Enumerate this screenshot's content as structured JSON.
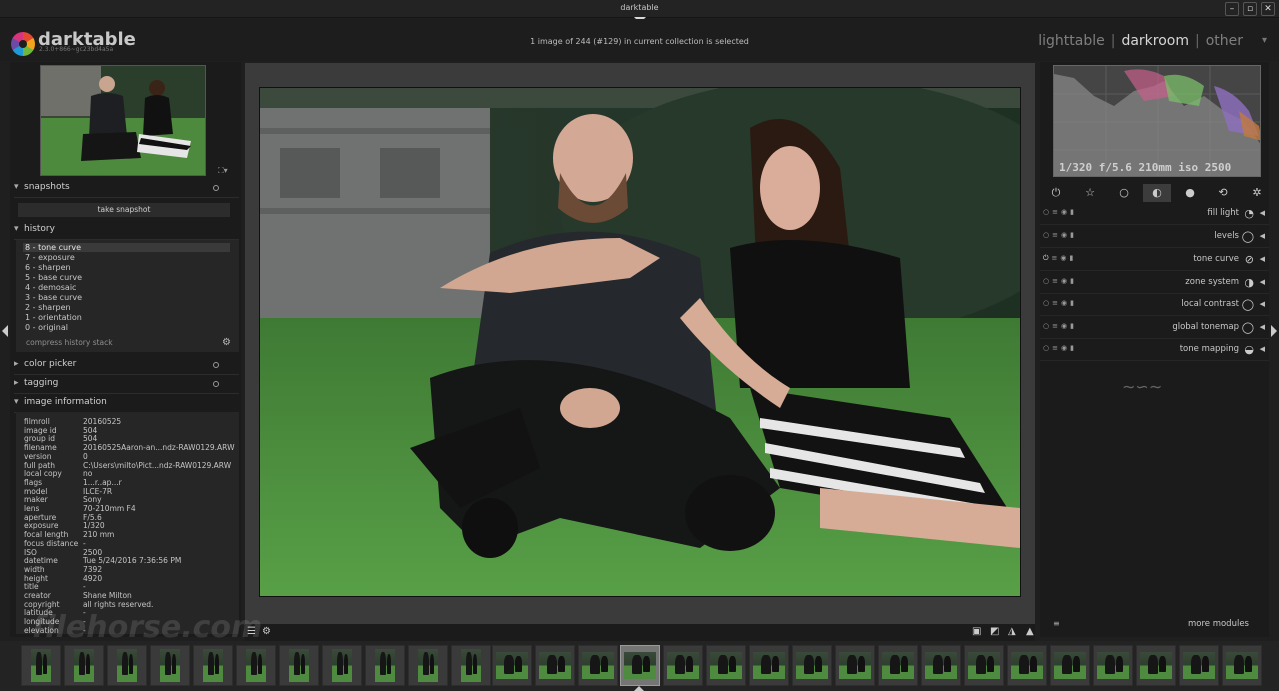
{
  "window": {
    "title": "darktable",
    "buttons": [
      "–",
      "▫",
      "✕"
    ]
  },
  "header": {
    "app_name": "darktable",
    "version": "2.3.0+866~gc23bd4a5a",
    "collection_status": "1 image of 244 (#129) in current collection is selected",
    "views": [
      {
        "label": "lighttable",
        "active": false
      },
      {
        "label": "darkroom",
        "active": true
      },
      {
        "label": "other",
        "active": false
      }
    ],
    "separator": "|"
  },
  "left": {
    "snapshots": {
      "title": "snapshots",
      "button": "take snapshot"
    },
    "history": {
      "title": "history",
      "items": [
        "8 - tone curve",
        "7 - exposure",
        "6 - sharpen",
        "5 - base curve",
        "4 - demosaic",
        "3 - base curve",
        "2 - sharpen",
        "1 - orientation",
        "0 - original"
      ],
      "selected": 0,
      "compress": "compress history stack"
    },
    "color_picker": {
      "title": "color picker"
    },
    "tagging": {
      "title": "tagging"
    },
    "image_information": {
      "title": "image information",
      "rows": [
        [
          "filmroll",
          "20160525"
        ],
        [
          "image id",
          "504"
        ],
        [
          "group id",
          "504"
        ],
        [
          "filename",
          "20160525Aaron-an...ndz-RAW0129.ARW"
        ],
        [
          "version",
          "0"
        ],
        [
          "full path",
          "C:\\Users\\milto\\Pict...ndz-RAW0129.ARW"
        ],
        [
          "local copy",
          "no"
        ],
        [
          "flags",
          "1...r..ap...r"
        ],
        [
          "model",
          "ILCE-7R"
        ],
        [
          "maker",
          "Sony"
        ],
        [
          "lens",
          "70-210mm F4"
        ],
        [
          "aperture",
          "F/5.6"
        ],
        [
          "exposure",
          "1/320"
        ],
        [
          "focal length",
          "210 mm"
        ],
        [
          "focus distance",
          "-"
        ],
        [
          "ISO",
          "2500"
        ],
        [
          "datetime",
          "Tue 5/24/2016 7:36:56 PM"
        ],
        [
          "width",
          "7392"
        ],
        [
          "height",
          "4920"
        ],
        [
          "title",
          "-"
        ],
        [
          "creator",
          "Shane Milton"
        ],
        [
          "copyright",
          "all rights reserved."
        ],
        [
          "latitude",
          "-"
        ],
        [
          "longitude",
          "-"
        ],
        [
          "elevation",
          "-"
        ]
      ]
    }
  },
  "right": {
    "histogram_exif": "1/320 f/5.6 210mm iso 2500",
    "modules": [
      {
        "name": "fill light",
        "icon": "fill-light-icon",
        "glyph": "◔"
      },
      {
        "name": "levels",
        "icon": "levels-icon",
        "glyph": "◯"
      },
      {
        "name": "tone curve",
        "icon": "tone-curve-icon",
        "glyph": "⊘"
      },
      {
        "name": "zone system",
        "icon": "zone-system-icon",
        "glyph": "◑"
      },
      {
        "name": "local contrast",
        "icon": "local-contrast-icon",
        "glyph": "◯"
      },
      {
        "name": "global tonemap",
        "icon": "global-tonemap-icon",
        "glyph": "◯"
      },
      {
        "name": "tone mapping",
        "icon": "tone-mapping-icon",
        "glyph": "◒"
      }
    ],
    "more_modules": "more modules"
  },
  "watermark": "filehorse.com"
}
